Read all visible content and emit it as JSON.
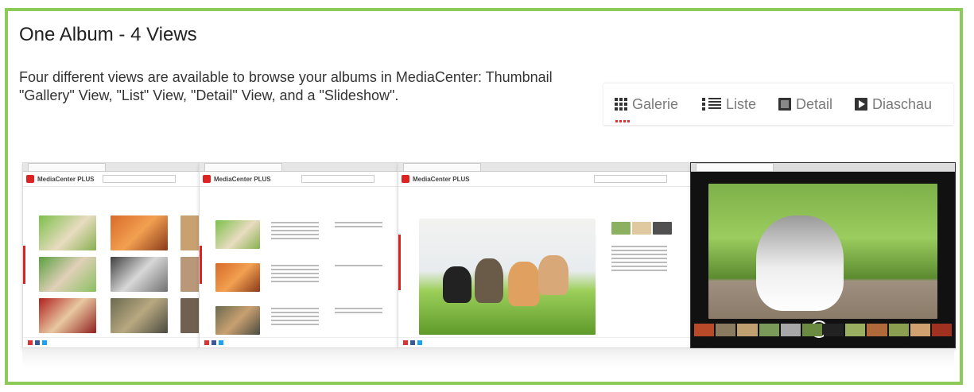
{
  "title": "One Album - 4 Views",
  "description": "Four different views are available to browse your albums in MediaCenter: Thumbnail \"Gallery\" View, \"List\" View, \"Detail\" View, and a \"Slideshow\".",
  "views": [
    {
      "label": "Galerie",
      "icon": "grid-icon",
      "active": true
    },
    {
      "label": "Liste",
      "icon": "list-icon",
      "active": false
    },
    {
      "label": "Detail",
      "icon": "detail-icon",
      "active": false
    },
    {
      "label": "Diaschau",
      "icon": "slideshow-icon",
      "active": false
    }
  ],
  "screens": {
    "app_name": "MediaCenter PLUS"
  },
  "colors": {
    "border": "#8ccb5a",
    "accent": "#d22222",
    "text_muted": "#7a7a7a"
  }
}
